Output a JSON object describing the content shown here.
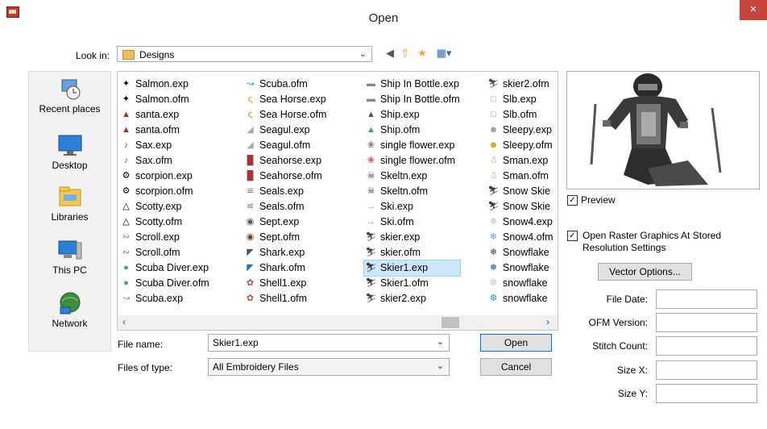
{
  "window": {
    "title": "Open",
    "close": "×"
  },
  "lookin": {
    "label": "Look in:",
    "value": "Designs"
  },
  "places": [
    {
      "label": "Recent places",
      "icon": "recent-places-icon"
    },
    {
      "label": "Desktop",
      "icon": "desktop-icon"
    },
    {
      "label": "Libraries",
      "icon": "libraries-icon"
    },
    {
      "label": "This PC",
      "icon": "this-pc-icon"
    },
    {
      "label": "Network",
      "icon": "network-icon"
    }
  ],
  "files": {
    "col1": [
      "Salmon.exp",
      "Salmon.ofm",
      "santa.exp",
      "santa.ofm",
      "Sax.exp",
      "Sax.ofm",
      "scorpion.exp",
      "scorpion.ofm",
      "Scotty.exp",
      "Scotty.ofm",
      "Scroll.exp",
      "Scroll.ofm",
      "Scuba Diver.exp",
      "Scuba Diver.ofm",
      "Scuba.exp"
    ],
    "col2": [
      "Scuba.ofm",
      "Sea Horse.exp",
      "Sea Horse.ofm",
      "Seagul.exp",
      "Seagul.ofm",
      "Seahorse.exp",
      "Seahorse.ofm",
      "Seals.exp",
      "Seals.ofm",
      "Sept.exp",
      "Sept.ofm",
      "Shark.exp",
      "Shark.ofm",
      "Shell1.exp",
      "Shell1.ofm"
    ],
    "col3": [
      "Ship In Bottle.exp",
      "Ship In Bottle.ofm",
      "Ship.exp",
      "Ship.ofm",
      "single flower.exp",
      "single flower.ofm",
      "Skeltn.exp",
      "Skeltn.ofm",
      "Ski.exp",
      "Ski.ofm",
      "skier.exp",
      "skier.ofm",
      "Skier1.exp",
      "Skier1.ofm",
      "skier2.exp"
    ],
    "col4": [
      "skier2.ofm",
      "Slb.exp",
      "Slb.ofm",
      "Sleepy.exp",
      "Sleepy.ofm",
      "Sman.exp",
      "Sman.ofm",
      "Snow Skie",
      "Snow Skie",
      "Snow4.exp",
      "Snow4.ofm",
      "Snowflake",
      "Snowflake",
      "snowflake",
      "snowflake"
    ],
    "selected": "Skier1.exp"
  },
  "filename": {
    "label": "File name:",
    "value": "Skier1.exp"
  },
  "filetype": {
    "label": "Files of type:",
    "value": "All Embroidery Files"
  },
  "buttons": {
    "open": "Open",
    "cancel": "Cancel",
    "vector": "Vector Options..."
  },
  "preview_check": {
    "label": "Preview",
    "checked": true
  },
  "raster_check": {
    "label1": "Open Raster Graphics At Stored",
    "label2": "Resolution Settings",
    "checked": true
  },
  "info": {
    "file_date": "File Date:",
    "ofm_version": "OFM Version:",
    "stitch_count": "Stitch Count:",
    "size_x": "Size X:",
    "size_y": "Size Y:"
  },
  "colors": {
    "close_bg": "#c7453b",
    "selection": "#cce8ff",
    "default_border": "#0078d7"
  }
}
